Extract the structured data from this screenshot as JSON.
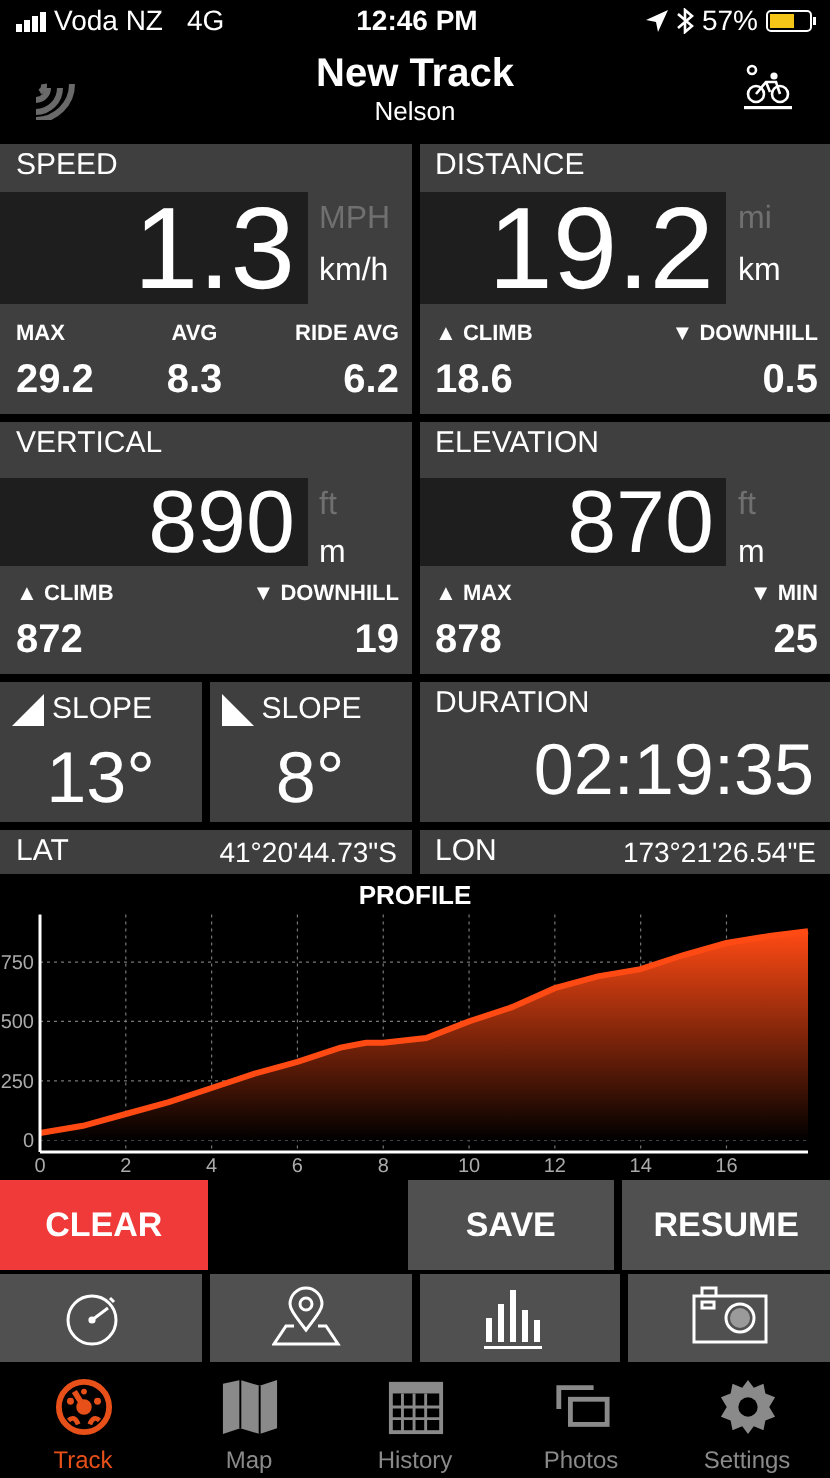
{
  "status_bar": {
    "carrier": "Voda NZ",
    "network": "4G",
    "time": "12:46 PM",
    "battery": "57%"
  },
  "header": {
    "title": "New Track",
    "subtitle": "Nelson"
  },
  "panels": [
    {
      "title": "SPEED",
      "value": "1.3",
      "units": [
        {
          "label": "MPH",
          "selected": false
        },
        {
          "label": "km/h",
          "selected": true
        }
      ],
      "stats": [
        {
          "label": "MAX",
          "value": "29.2"
        },
        {
          "label": "AVG",
          "value": "8.3"
        },
        {
          "label": "RIDE AVG",
          "value": "6.2"
        }
      ]
    },
    {
      "title": "DISTANCE",
      "value": "19.2",
      "units": [
        {
          "label": "mi",
          "selected": false
        },
        {
          "label": "km",
          "selected": true
        }
      ],
      "stats": [
        {
          "label": "▲ CLIMB",
          "value": "18.6"
        },
        {
          "label": "▼ DOWNHILL",
          "value": "0.5"
        }
      ]
    },
    {
      "title": "VERTICAL",
      "value": "890",
      "units": [
        {
          "label": "ft",
          "selected": false
        },
        {
          "label": "m",
          "selected": true
        }
      ],
      "stats": [
        {
          "label": "▲ CLIMB",
          "value": "872"
        },
        {
          "label": "▼ DOWNHILL",
          "value": "19"
        }
      ]
    },
    {
      "title": "ELEVATION",
      "value": "870",
      "units": [
        {
          "label": "ft",
          "selected": false
        },
        {
          "label": "m",
          "selected": true
        }
      ],
      "stats": [
        {
          "label": "▲ MAX",
          "value": "878"
        },
        {
          "label": "▼ MIN",
          "value": "25"
        }
      ]
    }
  ],
  "slopes": [
    {
      "kind": "uphill",
      "label": "SLOPE",
      "value": "13°"
    },
    {
      "kind": "downhill",
      "label": "SLOPE",
      "value": "8°"
    }
  ],
  "duration": {
    "label": "DURATION",
    "value": "02:19:35"
  },
  "coordinates": [
    {
      "label": "LAT",
      "value": "41°20'44.73\"S"
    },
    {
      "label": "LON",
      "value": "173°21'26.54\"E"
    }
  ],
  "profile": {
    "chart_data": {
      "type": "area",
      "title": "PROFILE",
      "x": [
        0,
        1,
        2,
        3,
        4,
        5,
        6,
        7,
        7.6,
        8,
        9,
        10,
        11,
        12,
        13,
        14,
        15,
        16,
        17,
        17.9
      ],
      "series": [
        {
          "color": "#ff4a14",
          "values": [
            30,
            60,
            110,
            160,
            220,
            280,
            330,
            390,
            410,
            410,
            430,
            500,
            560,
            640,
            690,
            720,
            780,
            830,
            860,
            880
          ]
        }
      ],
      "grid": true,
      "xlim": [
        0,
        17.9
      ],
      "ylim": [
        -50,
        950
      ],
      "xticks": [
        0,
        2,
        4,
        6,
        8,
        10,
        12,
        14,
        16
      ],
      "yticks": [
        0,
        250,
        500,
        750
      ]
    }
  },
  "actions": [
    {
      "kind": "danger",
      "label": "CLEAR"
    },
    {
      "kind": "spacer"
    },
    {
      "kind": "normal",
      "label": "SAVE"
    },
    {
      "kind": "normal",
      "label": "RESUME"
    }
  ],
  "tabs": [
    {
      "label": "Track",
      "selected": true
    },
    {
      "label": "Map",
      "selected": false
    },
    {
      "label": "History",
      "selected": false
    },
    {
      "label": "Photos",
      "selected": false
    },
    {
      "label": "Settings",
      "selected": false
    }
  ]
}
